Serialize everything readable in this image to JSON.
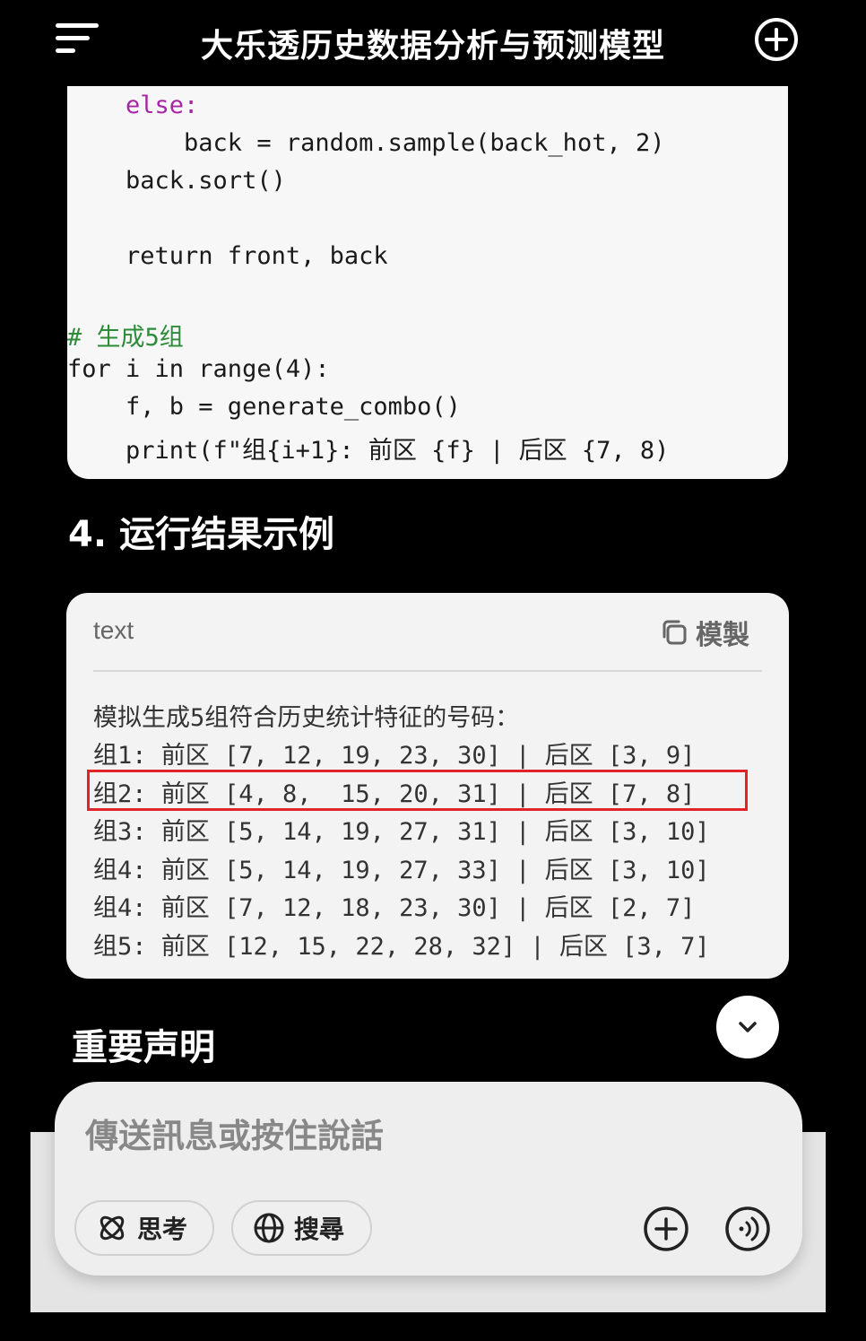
{
  "header": {
    "title": "大乐透历史数据分析与预测模型",
    "menu_icon": "hamburger-menu-icon",
    "new_chat_icon": "plus-circle-icon"
  },
  "code_block": {
    "lines": [
      "    else:",
      "        back = random.sample(back_hot, 2)",
      "    back.sort()",
      "",
      "    return front, back",
      "",
      "# 生成5组",
      "for i in range(4):",
      "    f, b = generate_combo()",
      "    print(f\"组{i+1}: 前区 {f} | 后区 {7, 8)"
    ]
  },
  "section_heading": "4. 运行结果示例",
  "output_block": {
    "language": "text",
    "copy_label": "模製",
    "copy_icon": "copy-icon",
    "lines": [
      "模拟生成5组符合历史统计特征的号码：",
      "组1: 前区 [7, 12, 19, 23, 30] | 后区 [3, 9]",
      "组2: 前区 [4, 8,  15, 20, 31] | 后区 [7, 8]",
      "组3: 前区 [5, 14, 19, 27, 31] | 后区 [3, 10]",
      "组4: 前区 [5, 14, 19, 27, 33] | 后区 [3, 10]",
      "组4: 前区 [7, 12, 18, 23, 30] | 后区 [2, 7]",
      "组5: 前区 [12, 15, 22, 28, 32] | 后区 [3, 7]"
    ],
    "highlighted_line_index": 2,
    "highlight_color": "#e0242a"
  },
  "notice_heading": "重要声明",
  "scroll_button_icon": "chevron-down-icon",
  "composer": {
    "placeholder": "傳送訊息或按住說話",
    "think_label": "思考",
    "think_icon": "atom-icon",
    "search_label": "搜尋",
    "search_icon": "globe-icon",
    "attach_icon": "plus-circle-icon",
    "voice_icon": "voice-wave-icon"
  }
}
